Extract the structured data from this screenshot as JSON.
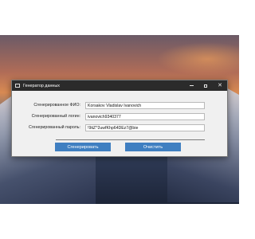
{
  "window": {
    "title": "Генератор данных"
  },
  "form": {
    "fio_label": "Сгенерированное ФИО:",
    "fio_value": "Korsakov Vladislav Ivanovich",
    "login_label": "Сгенерированный логин:",
    "login_value": "ivanovich9340377",
    "password_label": "Сгенерированный пароль:",
    "password_value": "!9tiZ^2uwfKhp64DEz7@bie"
  },
  "buttons": {
    "generate_label": "Сгенерировать",
    "clear_label": "Очистить"
  }
}
